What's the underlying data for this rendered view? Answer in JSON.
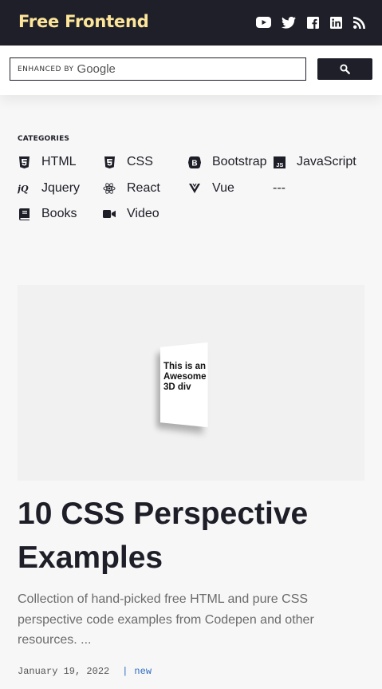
{
  "header": {
    "logo": "Free Frontend",
    "social": [
      "youtube-icon",
      "twitter-icon",
      "facebook-icon",
      "linkedin-icon",
      "rss-icon"
    ],
    "background": "#1e1f29",
    "logo_color": "#fde59a"
  },
  "search": {
    "enhanced_by": "ENHANCED BY",
    "brand": "Google",
    "button_icon": "search-icon"
  },
  "categories": {
    "title": "CATEGORIES",
    "items": [
      {
        "label": "HTML",
        "icon": "html5-icon"
      },
      {
        "label": "CSS",
        "icon": "css3-icon"
      },
      {
        "label": "Bootstrap",
        "icon": "bootstrap-icon"
      },
      {
        "label": "JavaScript",
        "icon": "js-icon"
      },
      {
        "label": "Jquery",
        "icon": "jquery-icon"
      },
      {
        "label": "React",
        "icon": "react-icon"
      },
      {
        "label": "Vue",
        "icon": "vue-icon"
      },
      {
        "label": "---",
        "icon": ""
      },
      {
        "label": "Books",
        "icon": "book-icon"
      },
      {
        "label": "Video",
        "icon": "video-icon"
      }
    ]
  },
  "article": {
    "image_text": "This is an Awesome 3D div",
    "title": "10 CSS Perspective Examples",
    "description": "Collection of hand-picked free HTML and pure CSS perspective code examples from Codepen and other resources. ...",
    "date": "January 19, 2022",
    "separator": "|",
    "tag": "new"
  }
}
